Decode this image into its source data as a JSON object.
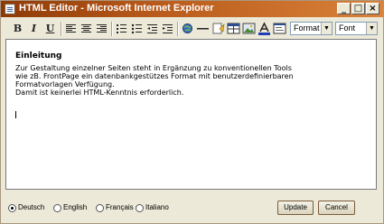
{
  "window": {
    "title": "HTML Editor - Microsoft Internet Explorer",
    "controls": {
      "minimize": "_",
      "maximize": "□",
      "close": "×"
    }
  },
  "toolbar": {
    "bold": "B",
    "italic": "I",
    "underline": "U",
    "format_select": "Format",
    "font_select": "Font"
  },
  "editor": {
    "heading": "Einleitung",
    "lines": [
      "Zur Gestaltung einzelner Seiten steht in Ergänzung zu konventionellen Tools",
      "wie zB. FrontPage ein datenbankgestützes Format mit benutzerdefinierbaren",
      "Formatvorlagen Verfügung.",
      "Damit ist keinerlei HTML-Kenntnis erforderlich."
    ]
  },
  "languages": {
    "options": [
      "Deutsch",
      "English",
      "Français",
      "Italiano"
    ],
    "selected": "Deutsch"
  },
  "buttons": {
    "update": "Update",
    "cancel": "Cancel"
  }
}
